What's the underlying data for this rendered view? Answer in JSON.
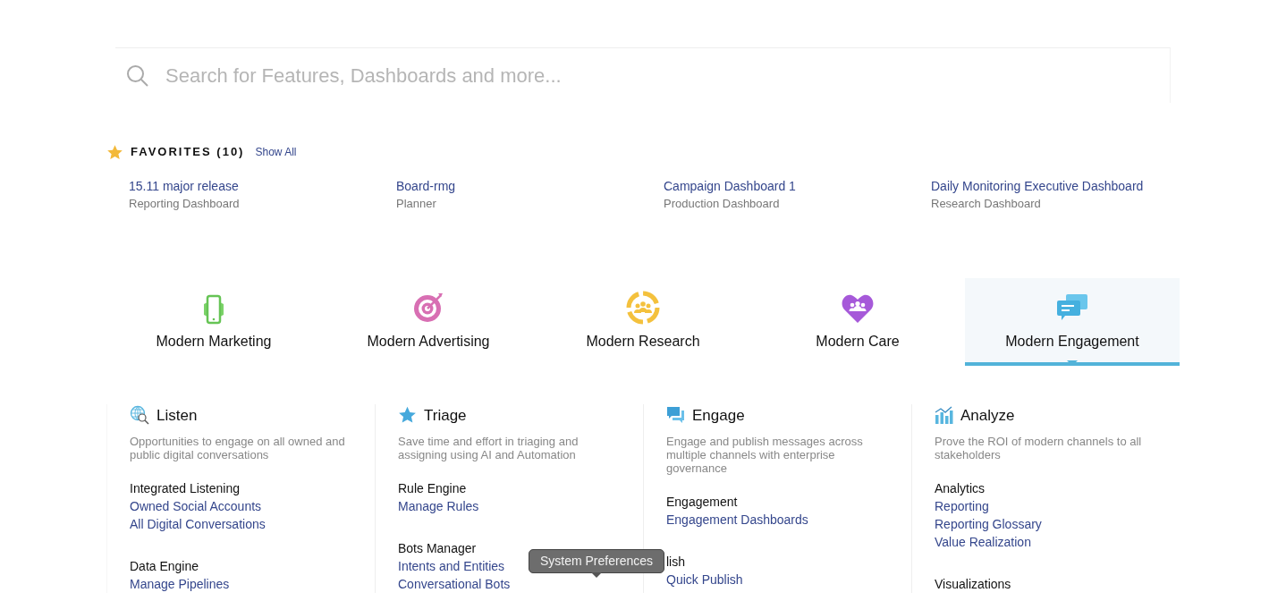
{
  "search": {
    "placeholder": "Search for Features, Dashboards and more..."
  },
  "favorites": {
    "title": "FAVORITES (10)",
    "show_all": "Show All",
    "items": [
      {
        "name": "15.11 major release",
        "type": "Reporting Dashboard"
      },
      {
        "name": "Board-rmg",
        "type": "Planner"
      },
      {
        "name": "Campaign Dashboard 1",
        "type": "Production Dashboard"
      },
      {
        "name": "Daily Monitoring Executive Dashboard",
        "type": "Research Dashboard"
      }
    ]
  },
  "products": [
    {
      "label": "Modern Marketing",
      "selected": false
    },
    {
      "label": "Modern Advertising",
      "selected": false
    },
    {
      "label": "Modern Research",
      "selected": false
    },
    {
      "label": "Modern Care",
      "selected": false
    },
    {
      "label": "Modern Engagement",
      "selected": true
    }
  ],
  "sections": [
    {
      "title": "Listen",
      "description": "Opportunities to engage on all owned and public digital conversations",
      "groups": [
        {
          "heading": "Integrated Listening",
          "links": [
            "Owned Social Accounts",
            "All Digital Conversations"
          ]
        },
        {
          "heading": "Data Engine",
          "links": [
            "Manage Pipelines"
          ]
        }
      ]
    },
    {
      "title": "Triage",
      "description": "Save time and effort in triaging and assigning using AI and Automation",
      "groups": [
        {
          "heading": "Rule Engine",
          "links": [
            "Manage Rules"
          ]
        },
        {
          "heading": "Bots Manager",
          "links": [
            "Intents and Entities",
            "Conversational Bots"
          ]
        }
      ]
    },
    {
      "title": "Engage",
      "description": "Engage and publish messages across multiple channels with enterprise governance",
      "groups": [
        {
          "heading": "Engagement",
          "links": [
            "Engagement Dashboards"
          ]
        },
        {
          "heading": "lish",
          "links": [
            "Quick Publish"
          ]
        }
      ]
    },
    {
      "title": "Analyze",
      "description": "Prove the ROI of modern channels to all stakeholders",
      "groups": [
        {
          "heading": "Analytics",
          "links": [
            "Reporting",
            "Reporting Glossary",
            "Value Realization"
          ]
        },
        {
          "heading": "Visualizations"
        }
      ]
    }
  ],
  "tooltip": "System Preferences"
}
